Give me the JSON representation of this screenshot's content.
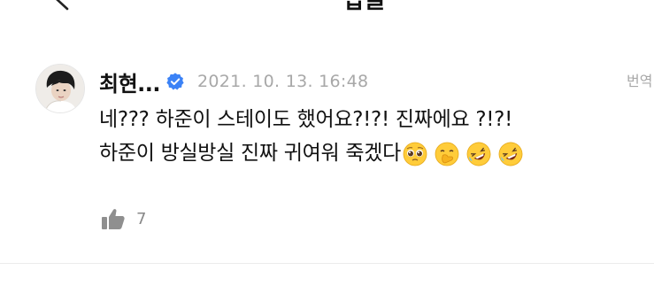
{
  "header": {
    "title": "답글",
    "back_icon": "chevron-left-icon"
  },
  "comment": {
    "author": "최현...",
    "verified_icon": "verified-badge-icon",
    "timestamp": "2021. 10. 13. 16:48",
    "translate_label": "번역",
    "text_line1": "네??? 하준이 스테이도 했어요?!?! 진짜에요 ?!?!",
    "text_line2": "하준이 방실방실 진짜 귀여워 죽겠다",
    "emojis": [
      "pleading-face-icon",
      "face-with-hand-over-mouth-icon",
      "rolling-on-floor-laughing-icon",
      "rolling-on-floor-laughing-icon"
    ],
    "like_icon": "thumbs-up-icon",
    "like_count": "7"
  },
  "colors": {
    "text": "#111111",
    "meta": "#a8a8a8",
    "verified": "#3b82f6",
    "divider": "#ececec"
  }
}
